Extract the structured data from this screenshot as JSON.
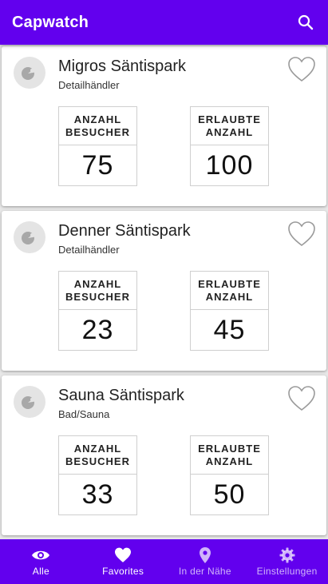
{
  "app": {
    "title": "Capwatch"
  },
  "cards": [
    {
      "name": "Migros Säntispark",
      "category": "Detailhändler",
      "visitors_label": "ANZAHL BESUCHER",
      "visitors": "75",
      "allowed_label": "ERLAUBTE ANZAHL",
      "allowed": "100"
    },
    {
      "name": "Denner Säntispark",
      "category": "Detailhändler",
      "visitors_label": "ANZAHL BESUCHER",
      "visitors": "23",
      "allowed_label": "ERLAUBTE ANZAHL",
      "allowed": "45"
    },
    {
      "name": "Sauna Säntispark",
      "category": "Bad/Sauna",
      "visitors_label": "ANZAHL BESUCHER",
      "visitors": "33",
      "allowed_label": "ERLAUBTE ANZAHL",
      "allowed": "50"
    }
  ],
  "nav": [
    {
      "label": "Alle",
      "icon": "eye-icon"
    },
    {
      "label": "Favorites",
      "icon": "heart-icon"
    },
    {
      "label": "In der Nähe",
      "icon": "location-pin-icon"
    },
    {
      "label": "Einstellungen",
      "icon": "gear-icon"
    }
  ],
  "colors": {
    "primary": "#6200ee"
  }
}
